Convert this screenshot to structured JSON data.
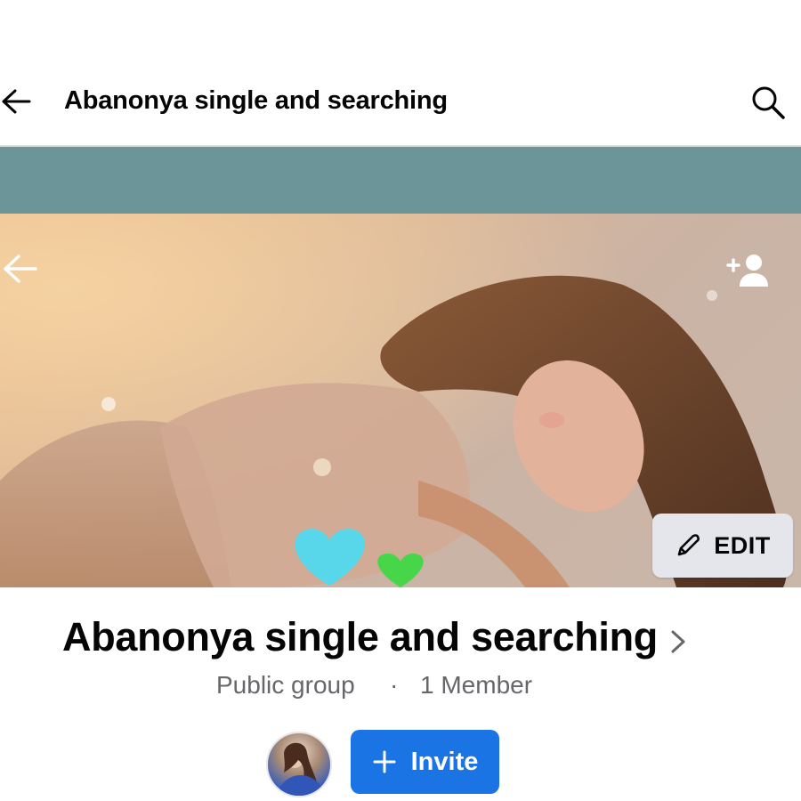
{
  "header": {
    "title": "Abanonya single and searching",
    "back_icon": "arrow-left-icon",
    "search_icon": "search-icon"
  },
  "cover": {
    "back_icon": "arrow-left-icon",
    "add_member_icon": "add-person-icon",
    "edit_label": "EDIT",
    "edit_icon": "pencil-icon"
  },
  "group": {
    "name": "Abanonya single and searching",
    "privacy": "Public group",
    "separator": "·",
    "members": "1 Member"
  },
  "actions": {
    "invite_label": "Invite",
    "invite_icon": "plus-icon"
  },
  "colors": {
    "accent": "#1b74e4",
    "cover_band": "#6b9598",
    "secondary_text": "#65676b",
    "edit_bg": "#e4e6eb"
  }
}
